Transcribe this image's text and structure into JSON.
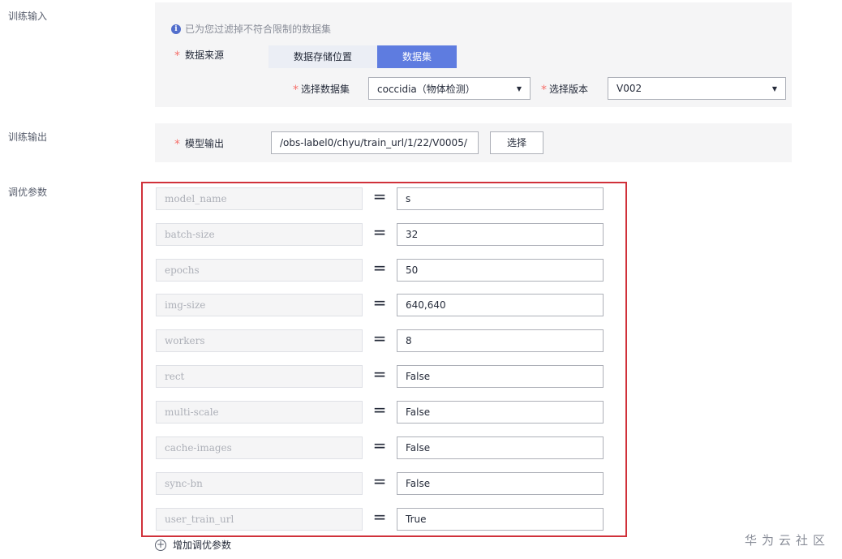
{
  "sections": {
    "train_input": "训练输入",
    "train_output": "训练输出",
    "tuning_params": "调优参数"
  },
  "input_panel": {
    "info_text": "已为您过滤掉不符合限制的数据集",
    "required_mark": "*",
    "source_label": "数据来源",
    "source_tabs": [
      "数据存储位置",
      "数据集"
    ],
    "dataset_label": "选择数据集",
    "dataset_value": "coccidia（物体检测）",
    "version_label": "选择版本",
    "version_value": "V002"
  },
  "output_panel": {
    "model_output_label": "模型输出",
    "model_output_path": "/obs-label0/chyu/train_url/1/22/V0005/",
    "select_button": "选择"
  },
  "equals_sign": "=",
  "params": [
    {
      "key": "model_name",
      "value": "s"
    },
    {
      "key": "batch-size",
      "value": "32"
    },
    {
      "key": "epochs",
      "value": "50"
    },
    {
      "key": "img-size",
      "value": "640,640"
    },
    {
      "key": "workers",
      "value": "8"
    },
    {
      "key": "rect",
      "value": "False"
    },
    {
      "key": "multi-scale",
      "value": "False"
    },
    {
      "key": "cache-images",
      "value": "False"
    },
    {
      "key": "sync-bn",
      "value": "False"
    },
    {
      "key": "user_train_url",
      "value": "True"
    }
  ],
  "add_param": {
    "icon_char": "+",
    "label": "增加调优参数"
  },
  "watermark": "华为云社区",
  "icons": {
    "info": "info-icon",
    "dropdown": "caret-down-icon",
    "add": "plus-circle-icon"
  },
  "colors": {
    "accent": "#5e7ce0",
    "required": "#f66f6a",
    "highlight_frame": "#d0313a",
    "info": "#526ecc"
  }
}
